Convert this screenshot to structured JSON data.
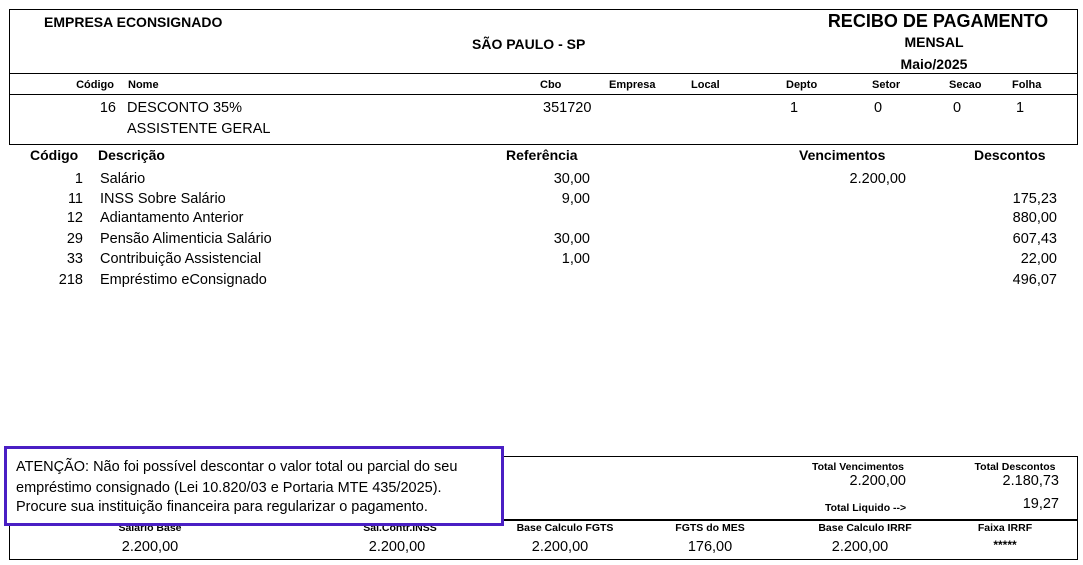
{
  "header": {
    "company": "EMPRESA ECONSIGNADO",
    "city": "SÃO PAULO - SP",
    "title": "RECIBO DE PAGAMENTO",
    "subtitle": "MENSAL",
    "period": "Maio/2025"
  },
  "employee_header": {
    "codigo": "Código",
    "nome": "Nome",
    "cbo": "Cbo",
    "empresa": "Empresa",
    "local": "Local",
    "depto": "Depto",
    "setor": "Setor",
    "secao": "Secao",
    "folha": "Folha"
  },
  "employee": {
    "codigo": "16",
    "nome": "DESCONTO 35%",
    "cargo": "ASSISTENTE GERAL",
    "cbo": "351720",
    "depto": "1",
    "setor": "0",
    "secao": "0",
    "folha": "1"
  },
  "items_header": {
    "codigo": "Código",
    "descricao": "Descrição",
    "referencia": "Referência",
    "vencimentos": "Vencimentos",
    "descontos": "Descontos"
  },
  "items": [
    {
      "codigo": "1",
      "descricao": "Salário",
      "referencia": "30,00",
      "vencimentos": "2.200,00",
      "descontos": ""
    },
    {
      "codigo": "11",
      "descricao": "INSS Sobre Salário",
      "referencia": "9,00",
      "vencimentos": "",
      "descontos": "175,23"
    },
    {
      "codigo": "12",
      "descricao": "Adiantamento Anterior",
      "referencia": "",
      "vencimentos": "",
      "descontos": "880,00"
    },
    {
      "codigo": "29",
      "descricao": "Pensão Alimenticia Salário",
      "referencia": "30,00",
      "vencimentos": "",
      "descontos": "607,43"
    },
    {
      "codigo": "33",
      "descricao": "Contribuição Assistencial",
      "referencia": "1,00",
      "vencimentos": "",
      "descontos": "22,00"
    },
    {
      "codigo": "218",
      "descricao": "Empréstimo eConsignado",
      "referencia": "",
      "vencimentos": "",
      "descontos": "496,07"
    }
  ],
  "notice": {
    "line1": "ATENÇÃO: Não foi possível descontar o valor total ou parcial do seu",
    "line2": "empréstimo consignado (Lei 10.820/03 e Portaria MTE 435/2025).",
    "line3": "Procure sua instituição financeira para regularizar o pagamento."
  },
  "totals": {
    "total_vencimentos_label": "Total Vencimentos",
    "total_vencimentos": "2.200,00",
    "total_descontos_label": "Total Descontos",
    "total_descontos": "2.180,73",
    "total_liquido_label": "Total Liquido -->",
    "total_liquido": "19,27"
  },
  "footer": {
    "salario_base_label": "Salário Base",
    "salario_base": "2.200,00",
    "sal_contr_inss_label": "Sal.Contr.INSS",
    "sal_contr_inss": "2.200,00",
    "base_fgts_label": "Base Calculo FGTS",
    "base_fgts": "2.200,00",
    "fgts_mes_label": "FGTS do MES",
    "fgts_mes": "176,00",
    "base_irrf_label": "Base Calculo IRRF",
    "base_irrf": "2.200,00",
    "faixa_irrf_label": "Faixa IRRF",
    "faixa_irrf": "*****"
  },
  "colors": {
    "callout_border": "#4a1fc4"
  }
}
